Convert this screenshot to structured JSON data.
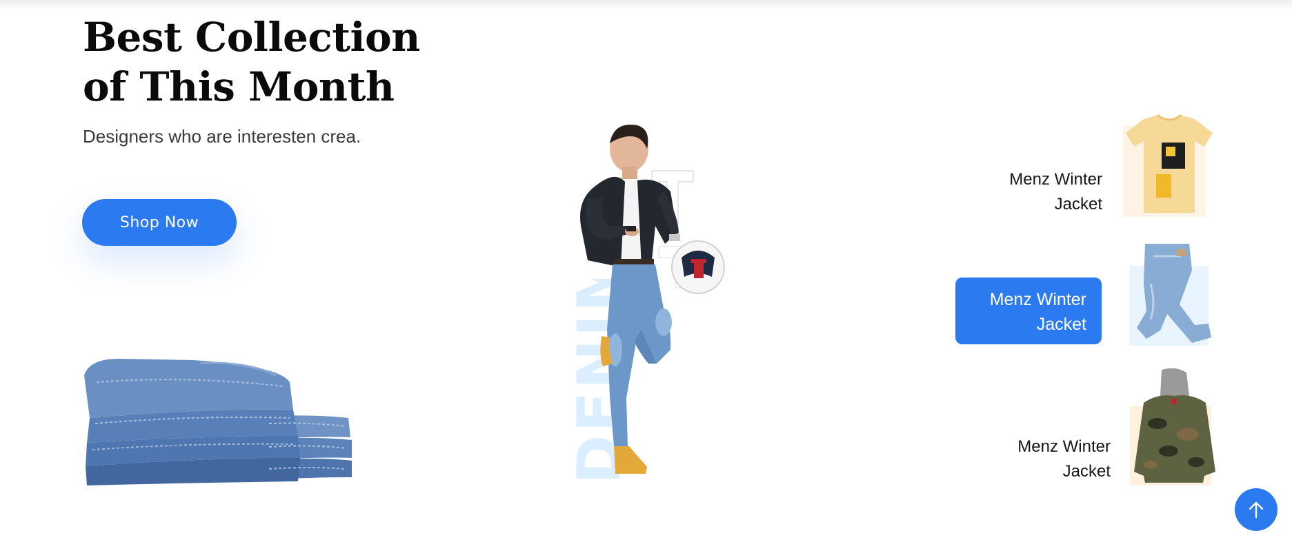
{
  "hero": {
    "title": "Best Collection of This Month",
    "subtitle": "Designers who are interesten crea.",
    "cta_label": "Shop Now"
  },
  "feature": {
    "vertical_text": "DENIM"
  },
  "products": [
    {
      "label": "Menz Winter Jacket",
      "thumb": "yellow-tshirt",
      "active": false
    },
    {
      "label": "Menz Winter Jacket",
      "thumb": "blue-jeans",
      "active": true
    },
    {
      "label": "Menz Winter Jacket",
      "thumb": "camo-hoodie-jacket",
      "active": false
    }
  ],
  "icons": {
    "scroll_top": "arrow-up-icon"
  },
  "colors": {
    "accent": "#2c7af0",
    "denim_text": "#dbeeff",
    "text_dark": "#0a0a0a",
    "text_muted": "#3a3a3a"
  }
}
